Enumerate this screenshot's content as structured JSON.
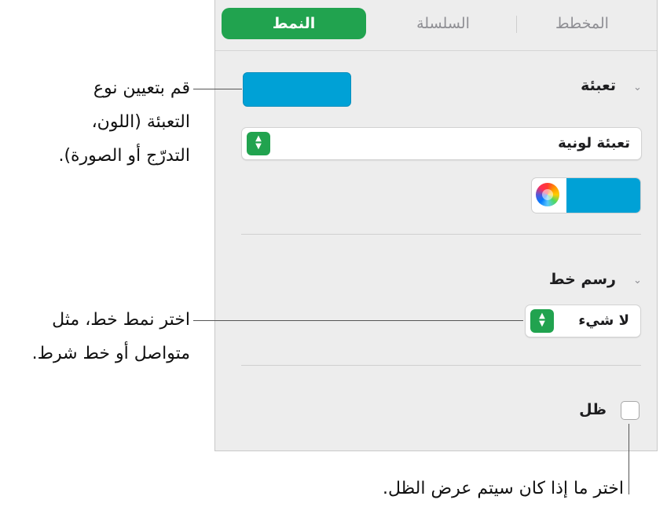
{
  "tabs": {
    "arrange": "المخطط",
    "series": "السلسلة",
    "style": "النمط"
  },
  "fill": {
    "title": "تعبئة",
    "type_value": "تعبئة لونية",
    "color": "#00a1d6"
  },
  "stroke": {
    "title": "رسم خط",
    "style_value": "لا شيء"
  },
  "shadow": {
    "label": "ظل",
    "checked": false
  },
  "callouts": {
    "fill_line1": "قم بتعيين نوع",
    "fill_line2": "التعبئة (اللون،",
    "fill_line3": "التدرّج أو الصورة).",
    "stroke_line1": "اختر نمط خط، مثل",
    "stroke_line2": "متواصل أو خط شرط.",
    "shadow": "اختر ما إذا كان سيتم عرض الظل."
  },
  "icons": {
    "disclosure": "chevron-down-icon",
    "stepper": "up-down-chevron-icon",
    "color_wheel": "color-wheel-icon"
  },
  "colors": {
    "accent": "#21a34f",
    "swatch": "#00a1d6"
  }
}
